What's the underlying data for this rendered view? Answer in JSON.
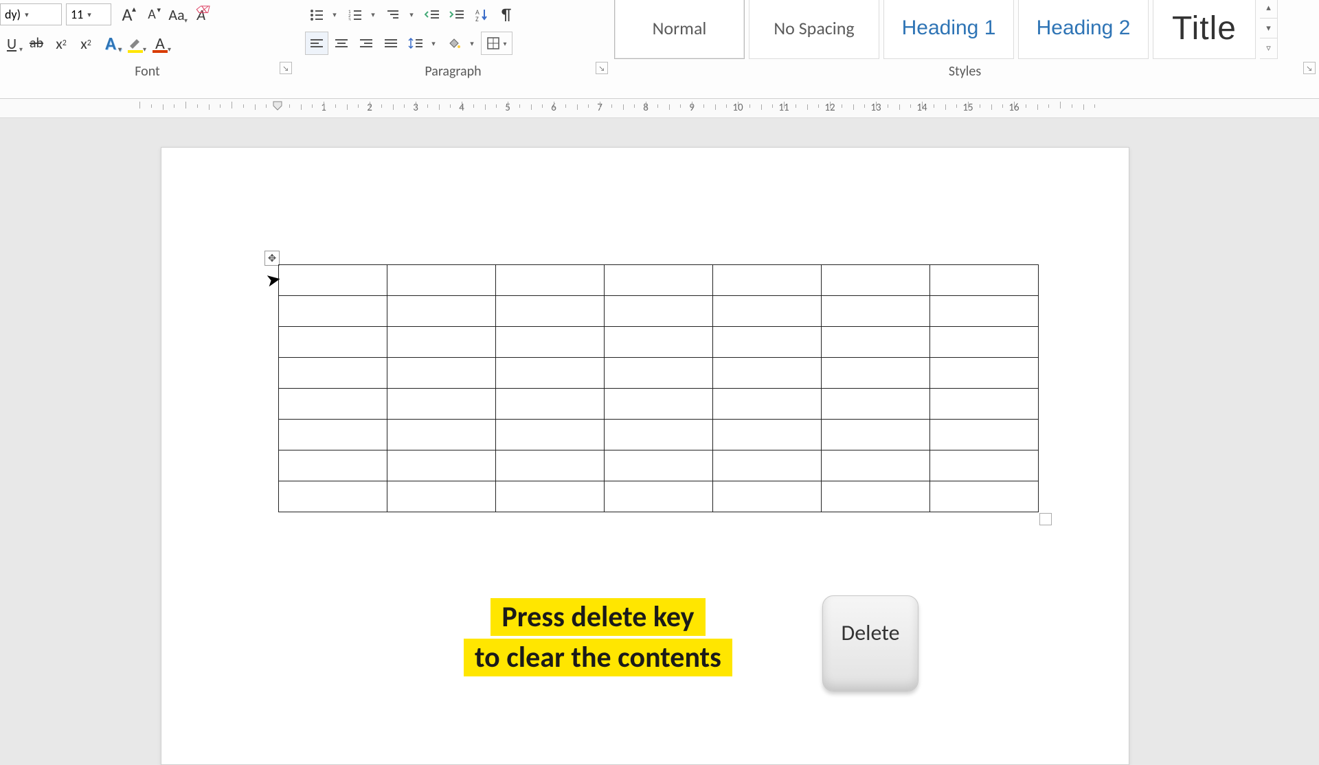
{
  "ribbon": {
    "font": {
      "label": "Font",
      "font_name_partial": "dy)",
      "font_size": "11",
      "grow_glyph": "A",
      "shrink_glyph": "A",
      "case_glyph": "Aa",
      "subscript_glyph": "x",
      "superscript_glyph": "x"
    },
    "paragraph": {
      "label": "Paragraph"
    },
    "styles": {
      "label": "Styles",
      "items": [
        "Normal",
        "No Spacing",
        "Heading 1",
        "Heading 2",
        "Title"
      ]
    }
  },
  "ruler": {
    "numbers": [
      1,
      2,
      3,
      4,
      5,
      6,
      7,
      8,
      9,
      10,
      11,
      12,
      13,
      14,
      15,
      16
    ]
  },
  "table": {
    "rows": 8,
    "cols": 7
  },
  "callout": {
    "line1": "Press delete key",
    "line2": "to clear the contents"
  },
  "keycap": {
    "label": "Delete"
  }
}
